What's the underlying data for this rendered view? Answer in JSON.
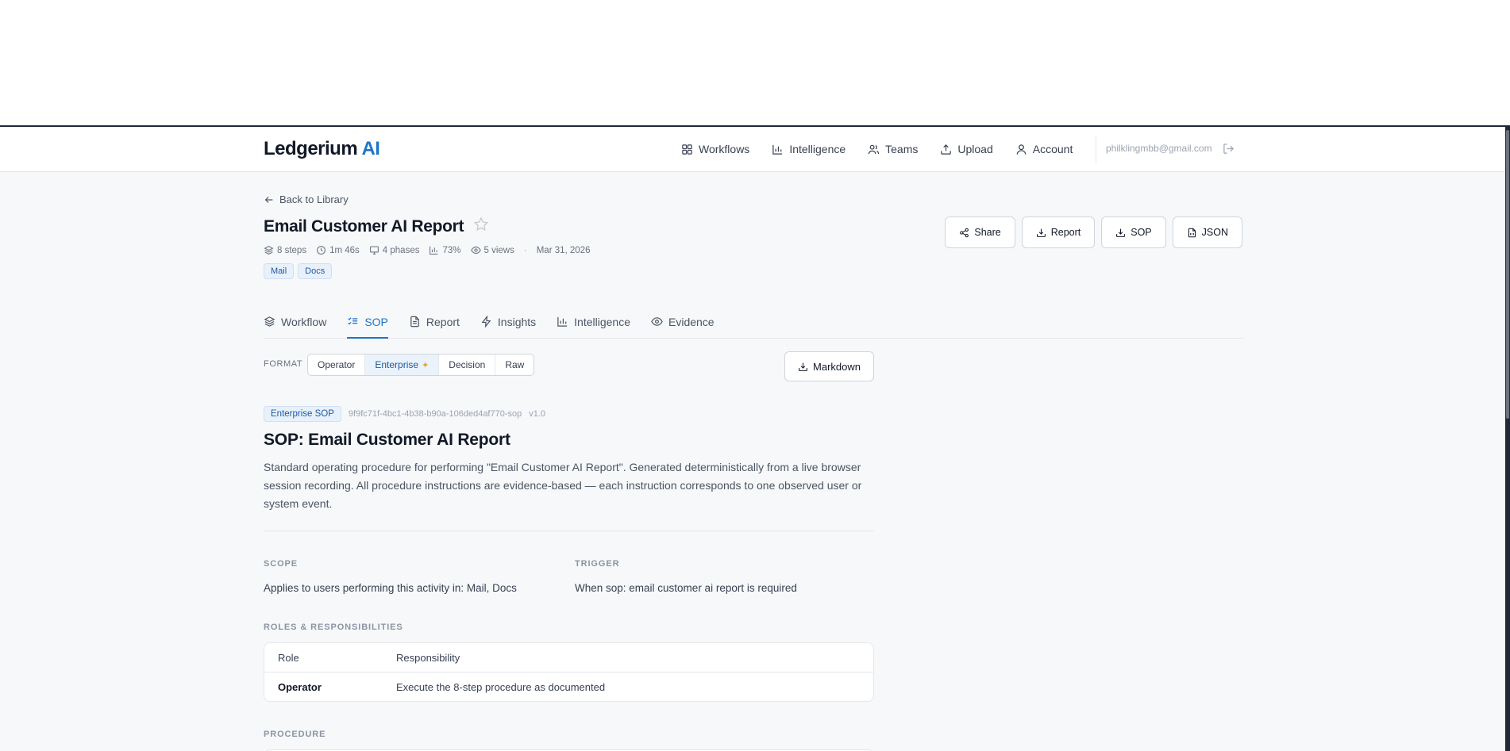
{
  "brand": {
    "name": "Ledgerium",
    "suffix": "AI"
  },
  "nav": [
    {
      "label": "Workflows",
      "icon": "grid-icon"
    },
    {
      "label": "Intelligence",
      "icon": "bar-chart-icon"
    },
    {
      "label": "Teams",
      "icon": "users-icon"
    },
    {
      "label": "Upload",
      "icon": "upload-icon"
    },
    {
      "label": "Account",
      "icon": "user-icon"
    }
  ],
  "user": {
    "email": "philklingmbb@gmail.com"
  },
  "back_label": "Back to Library",
  "workflow": {
    "title": "Email Customer AI Report",
    "steps": "8 steps",
    "duration": "1m 46s",
    "phases": "4 phases",
    "score": "73%",
    "views": "5 views",
    "date": "Mar 31, 2026",
    "tags": [
      "Mail",
      "Docs"
    ]
  },
  "actions": {
    "share": "Share",
    "report": "Report",
    "sop": "SOP",
    "json": "JSON"
  },
  "tabs": [
    {
      "label": "Workflow",
      "active": false
    },
    {
      "label": "SOP",
      "active": true
    },
    {
      "label": "Report",
      "active": false
    },
    {
      "label": "Insights",
      "active": false
    },
    {
      "label": "Intelligence",
      "active": false
    },
    {
      "label": "Evidence",
      "active": false
    }
  ],
  "format": {
    "label": "FORMAT",
    "options": [
      "Operator",
      "Enterprise",
      "Decision",
      "Raw"
    ],
    "selected": "Enterprise",
    "markdown_label": "Markdown"
  },
  "sop": {
    "badge": "Enterprise SOP",
    "id": "9f9fc71f-4bc1-4b38-b90a-106ded4af770-sop",
    "version": "v1.0",
    "title": "SOP: Email Customer AI Report",
    "description": "Standard operating procedure for performing \"Email Customer AI Report\". Generated deterministically from a live browser session recording. All procedure instructions are evidence-based — each instruction corresponds to one observed user or system event.",
    "scope_label": "SCOPE",
    "scope_text": "Applies to users performing this activity in: Mail, Docs",
    "trigger_label": "TRIGGER",
    "trigger_text": "When sop: email customer ai report is required",
    "roles_label": "ROLES & RESPONSIBILITIES",
    "roles_headers": [
      "Role",
      "Responsibility"
    ],
    "roles": [
      {
        "role": "Operator",
        "responsibility": "Execute the 8-step procedure as documented"
      }
    ],
    "procedure_label": "PROCEDURE"
  },
  "colors": {
    "accent": "#1d75c9",
    "background": "#f6f8fa",
    "badge_bg": "#e8f1fb"
  }
}
